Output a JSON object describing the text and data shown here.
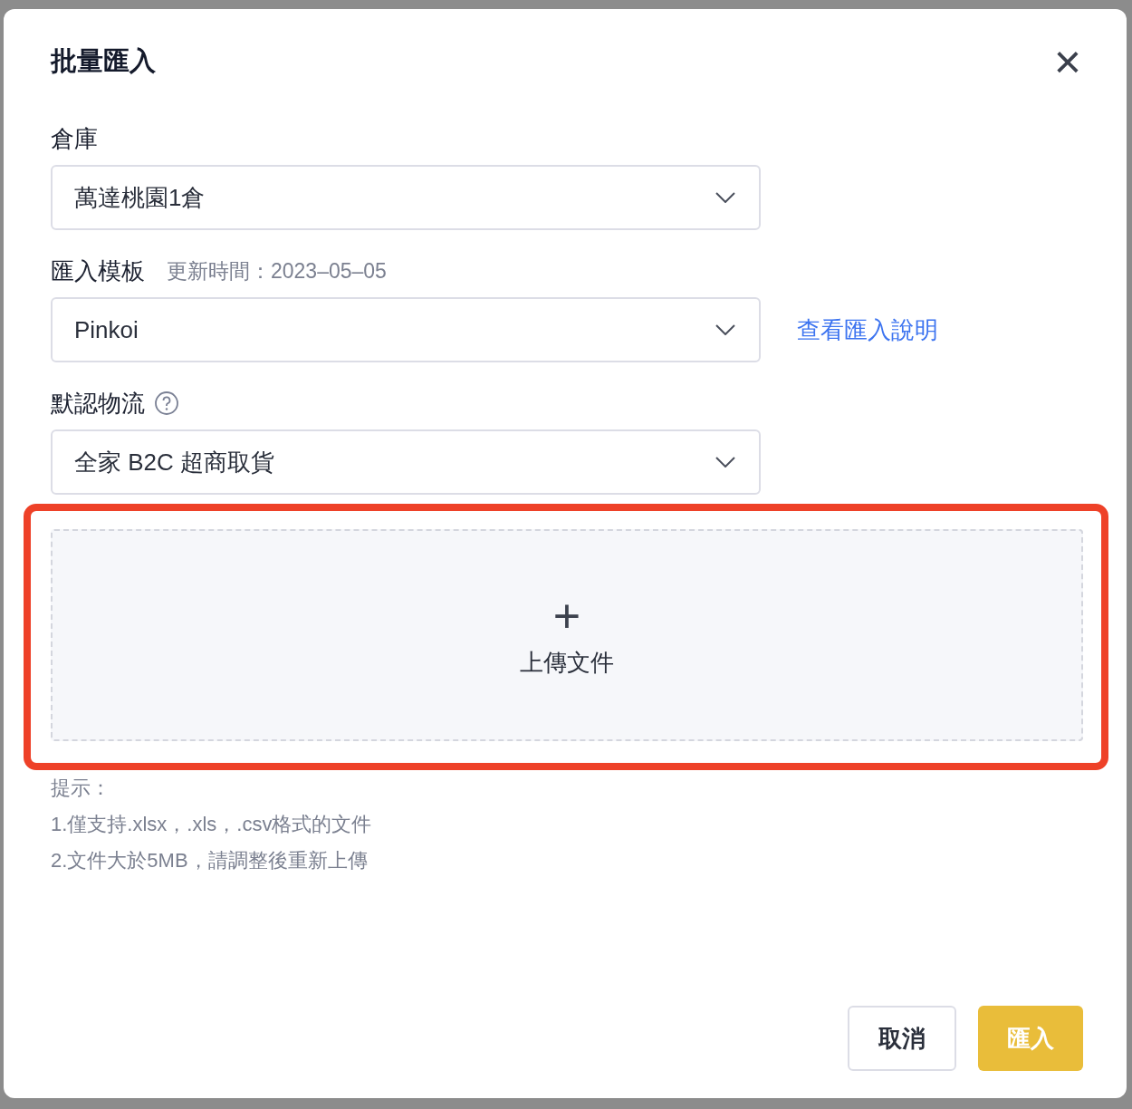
{
  "dialog": {
    "title": "批量匯入",
    "close": "×"
  },
  "fields": [
    {
      "label": "倉庫",
      "value": "萬達桃園1倉"
    },
    {
      "label": "匯入模板",
      "note": "更新時間：2023–05–05",
      "value": "Pinkoi",
      "link": "查看匯入說明"
    },
    {
      "label": "默認物流",
      "help": true,
      "value": "全家 B2C 超商取貨"
    }
  ],
  "upload": {
    "icon": "+",
    "label": "上傳文件",
    "highlighted": true
  },
  "hints": [
    "提示：",
    "1.僅支持.xlsx，.xls，.csv格式的文件",
    "2.文件大於5MB，請調整後重新上傳"
  ],
  "buttons": [
    {
      "label": "取消",
      "kind": "secondary",
      "disabled": false
    },
    {
      "label": "匯入",
      "kind": "primary",
      "disabled": true
    }
  ]
}
